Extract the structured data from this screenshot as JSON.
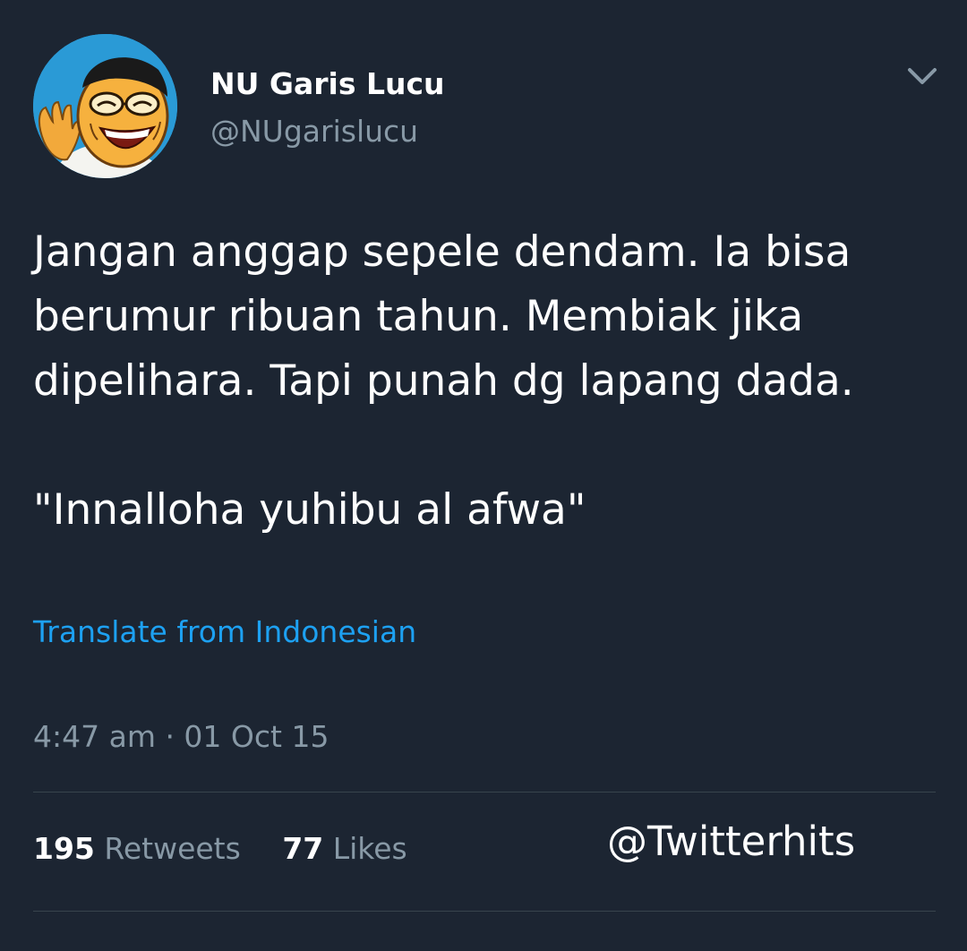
{
  "user": {
    "display_name": "NU Garis Lucu",
    "handle": "@NUgarislucu"
  },
  "tweet": {
    "lines": [
      "Jangan anggap sepele dendam. Ia bisa",
      "berumur ribuan tahun. Membiak jika",
      "dipelihara. Tapi punah dg lapang dada.",
      "\"Innalloha yuhibu al afwa\""
    ],
    "translate_label": "Translate from Indonesian",
    "timestamp": "4:47 am · 01 Oct 15"
  },
  "stats": {
    "retweets_count": "195",
    "retweets_label": "Retweets",
    "likes_count": "77",
    "likes_label": "Likes"
  },
  "watermark": "@Twitterhits",
  "icons": {
    "menu": "chevron-down-icon"
  },
  "colors": {
    "background": "#1c2532",
    "link": "#1da1f2",
    "secondary_text": "#8899a6",
    "divider": "#38444d"
  }
}
